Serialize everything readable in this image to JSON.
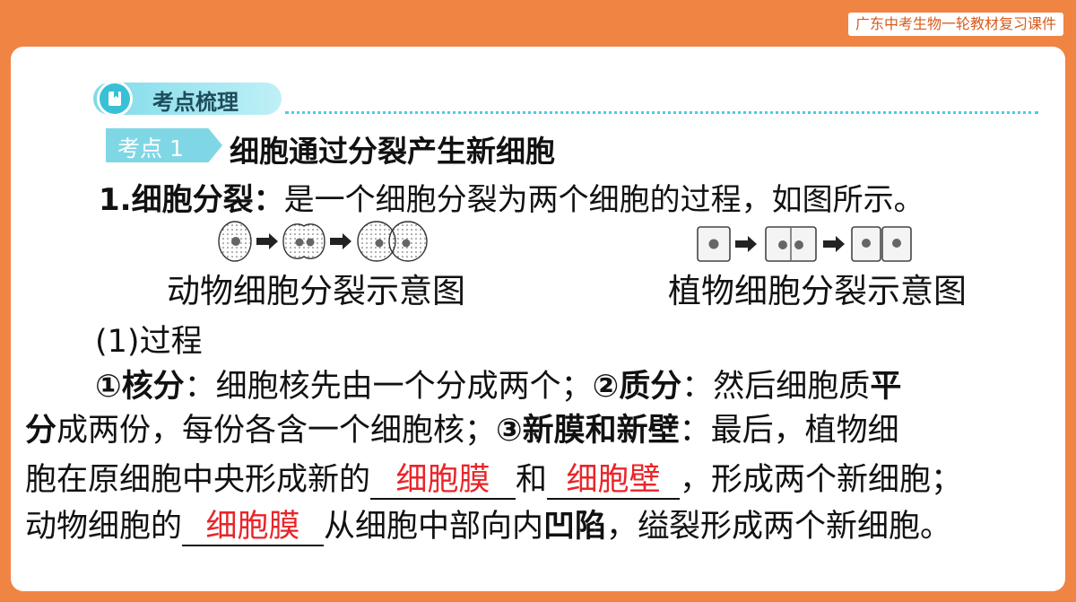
{
  "header": {
    "course_tag": "广东中考生物一轮教材复习课件"
  },
  "section": {
    "label": "考点梳理",
    "icon": "bookmark-icon"
  },
  "topic": {
    "tag": "考点 1",
    "title": "细胞通过分裂产生新细胞"
  },
  "definition": {
    "term": "1.细胞分裂：",
    "text": "是一个细胞分裂为两个细胞的过程，如图所示。"
  },
  "figures": {
    "animal_caption": "动物细胞分裂示意图",
    "plant_caption": "植物细胞分裂示意图"
  },
  "process": {
    "heading": "(1)过程",
    "p1_k1": "①核分",
    "p1_t1": "：细胞核先由一个分成两个；",
    "p1_k2": "②质分",
    "p1_t2": "：然后细胞质",
    "p1_k3": "平",
    "p2_k1": "分",
    "p2_t1": "成两份，每份各含一个细胞核；",
    "p2_k2": "③新膜和新壁",
    "p2_t2": "：最后，植物细",
    "p3_t1": "胞在原细胞中央形成新的",
    "p3_blank1": "细胞膜",
    "p3_t2": "和",
    "p3_blank2": "细胞壁",
    "p3_t3": "，形成两个新细胞；",
    "p4_t1": "动物细胞的",
    "p4_blank1": "细胞膜",
    "p4_t2": "从细胞中部向内",
    "p4_k1": "凹陷",
    "p4_t3": "，缢裂形成两个新细胞。"
  },
  "colors": {
    "frame": "#f08443",
    "accent": "#38c1d6",
    "answer": "#e8252a"
  }
}
